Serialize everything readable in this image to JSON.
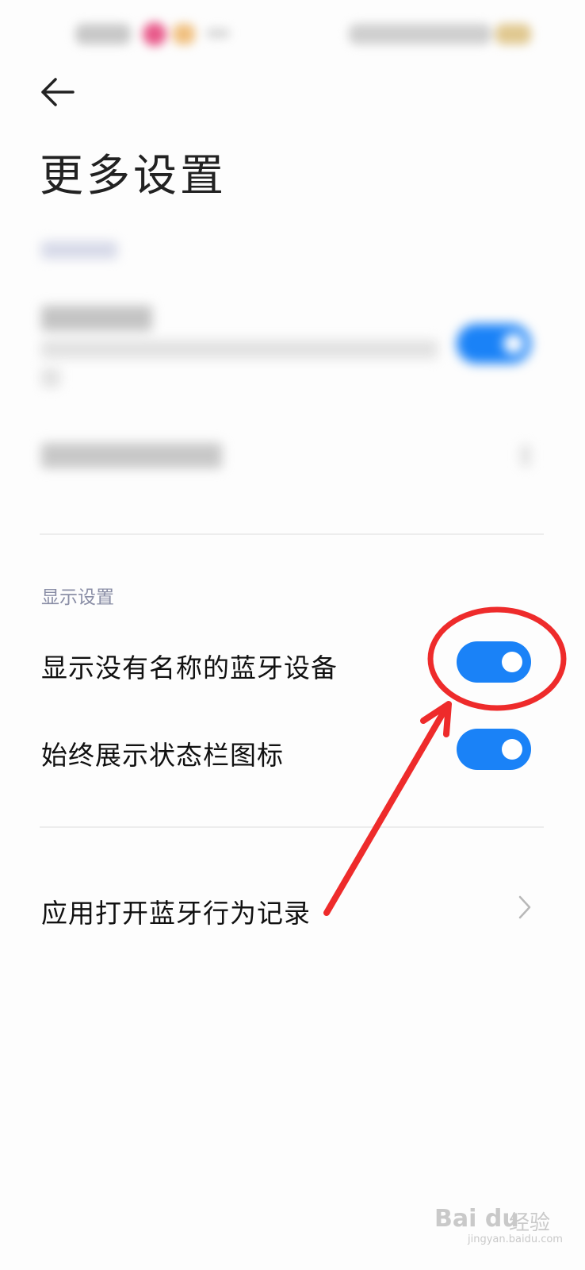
{
  "page_title": "更多设置",
  "display_section": {
    "header": "显示设置",
    "items": [
      {
        "label": "显示没有名称的蓝牙设备",
        "toggle_on": true
      },
      {
        "label": "始终展示状态栏图标",
        "toggle_on": true
      }
    ]
  },
  "records_item": {
    "label": "应用打开蓝牙行为记录"
  },
  "colors": {
    "accent": "#1a82f7",
    "annotation": "#ee2b2b",
    "section_header": "#8a8ea6",
    "divider": "#ededed"
  },
  "icons": {
    "back": "arrow-left-icon",
    "chevron": "chevron-right-icon"
  },
  "watermark": {
    "brand": "Bai du",
    "cn": "经验",
    "url": "jingyan.baidu.com"
  }
}
